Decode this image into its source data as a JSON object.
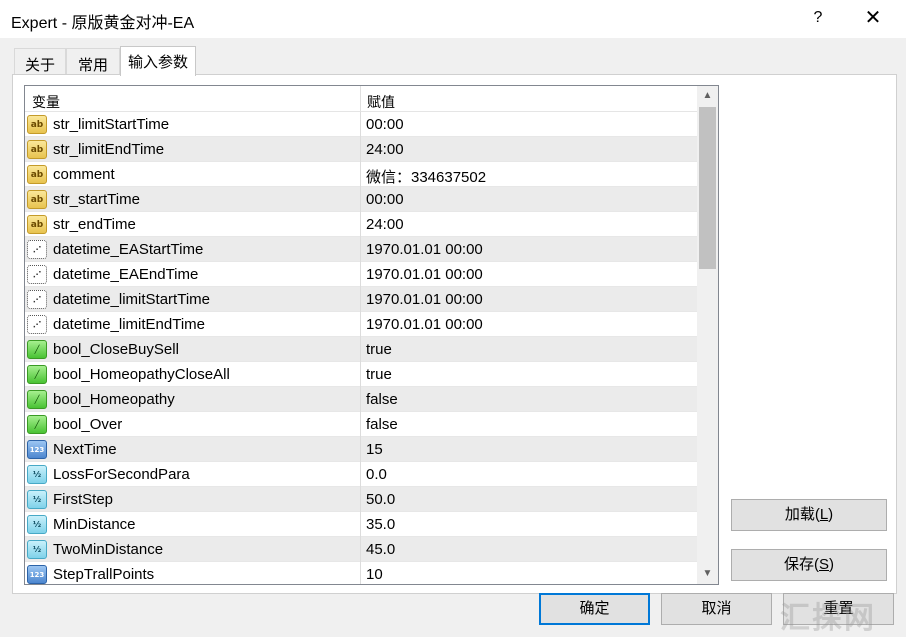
{
  "window": {
    "title": "Expert - 原版黄金对冲-EA",
    "help_glyph": "?",
    "close_glyph": "✕"
  },
  "tabs": [
    {
      "label": "关于",
      "active": false
    },
    {
      "label": "常用",
      "active": false
    },
    {
      "label": "输入参数",
      "active": true
    }
  ],
  "grid": {
    "headers": {
      "variable": "变量",
      "value": "赋值"
    },
    "rows": [
      {
        "icon": "string-icon",
        "name": "str_limitStartTime",
        "value": "00:00"
      },
      {
        "icon": "string-icon",
        "name": "str_limitEndTime",
        "value": "24:00"
      },
      {
        "icon": "string-icon",
        "name": "comment",
        "value": "微信：334637502"
      },
      {
        "icon": "string-icon",
        "name": "str_startTime",
        "value": "00:00"
      },
      {
        "icon": "string-icon",
        "name": "str_endTime",
        "value": "24:00"
      },
      {
        "icon": "datetime-icon",
        "name": "datetime_EAStartTime",
        "value": "1970.01.01 00:00"
      },
      {
        "icon": "datetime-icon",
        "name": "datetime_EAEndTime",
        "value": "1970.01.01 00:00"
      },
      {
        "icon": "datetime-icon",
        "name": "datetime_limitStartTime",
        "value": "1970.01.01 00:00"
      },
      {
        "icon": "datetime-icon",
        "name": "datetime_limitEndTime",
        "value": "1970.01.01 00:00"
      },
      {
        "icon": "bool-icon",
        "name": "bool_CloseBuySell",
        "value": "true"
      },
      {
        "icon": "bool-icon",
        "name": "bool_HomeopathyCloseAll",
        "value": "true"
      },
      {
        "icon": "bool-icon",
        "name": "bool_Homeopathy",
        "value": "false"
      },
      {
        "icon": "bool-icon",
        "name": "bool_Over",
        "value": "false"
      },
      {
        "icon": "integer-icon",
        "name": "NextTime",
        "value": "15"
      },
      {
        "icon": "double-icon",
        "name": "LossForSecondPara",
        "value": "0.0"
      },
      {
        "icon": "double-icon",
        "name": "FirstStep",
        "value": "50.0"
      },
      {
        "icon": "double-icon",
        "name": "MinDistance",
        "value": "35.0"
      },
      {
        "icon": "double-icon",
        "name": "TwoMinDistance",
        "value": "45.0"
      },
      {
        "icon": "integer-icon",
        "name": "StepTrallPoints",
        "value": "10"
      }
    ],
    "icon_glyphs": {
      "string-icon": "ab",
      "datetime-icon": "⋰",
      "bool-icon": "╱",
      "integer-icon": "123",
      "double-icon": "½"
    }
  },
  "buttons": {
    "load": {
      "label": "加载",
      "accel": "L"
    },
    "save": {
      "label": "保存",
      "accel": "S"
    },
    "ok": {
      "label": "确定"
    },
    "cancel": {
      "label": "取消"
    },
    "reset": {
      "label": "重置"
    }
  },
  "watermark": "汇探网",
  "colors": {
    "row_alt": "#ebebeb",
    "primary_border": "#0078d7"
  }
}
